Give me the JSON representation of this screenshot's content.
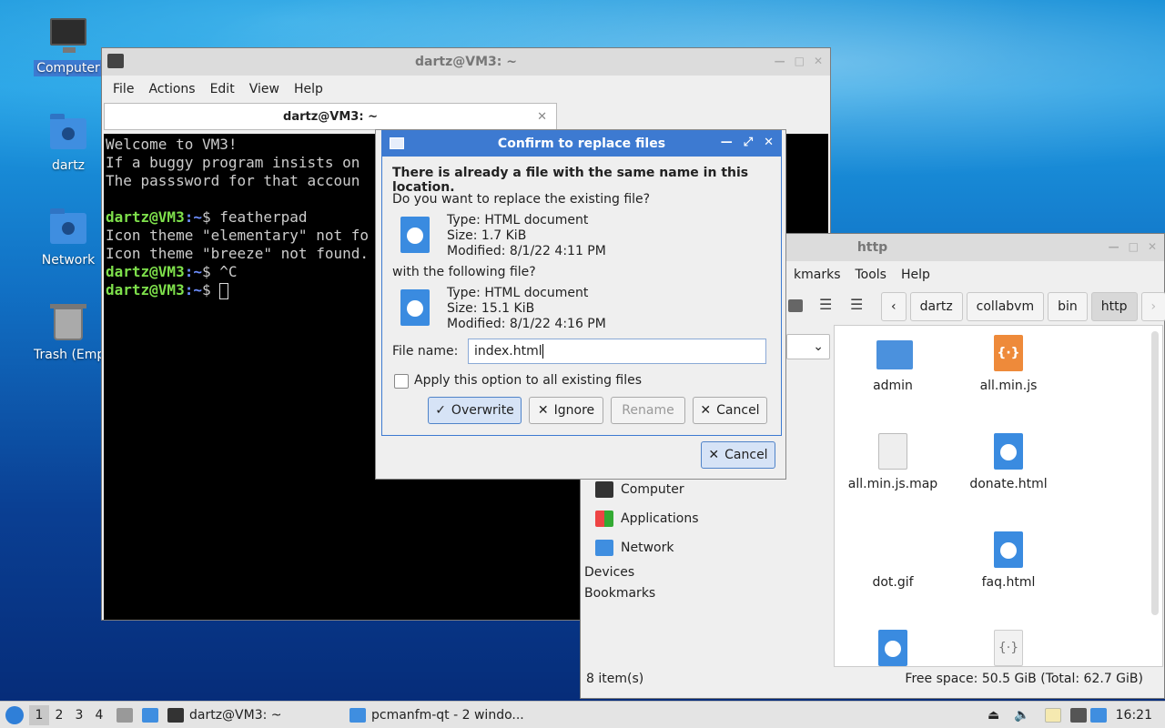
{
  "desktop": {
    "icons": [
      {
        "label": "Computer"
      },
      {
        "label": "dartz"
      },
      {
        "label": "Network"
      },
      {
        "label": "Trash (Empt"
      }
    ]
  },
  "terminal": {
    "title": "dartz@VM3: ~",
    "menu": [
      "File",
      "Actions",
      "Edit",
      "View",
      "Help"
    ],
    "tab_title": "dartz@VM3: ~",
    "lines": {
      "l1": "Welcome to VM3!",
      "l2": "If a buggy program insists on",
      "l3": "The passsword for that accoun",
      "l5_cmd": "featherpad",
      "l6": "Icon theme \"elementary\" not fo",
      "l7": "Icon theme \"breeze\" not found.",
      "l8_cmd": "^C"
    },
    "prompt_user": "dartz@VM3",
    "prompt_path": ":~",
    "prompt_sym": "$ "
  },
  "filemanager": {
    "title": "http",
    "menu": [
      "kmarks",
      "Tools",
      "Help"
    ],
    "breadcrumbs": [
      "dartz",
      "collabvm",
      "bin",
      "http"
    ],
    "side": {
      "computer": "Computer",
      "applications": "Applications",
      "network": "Network",
      "devices": "Devices",
      "bookmarks": "Bookmarks"
    },
    "files": [
      "admin",
      "all.min.js",
      "all.min.js.map",
      "donate.html",
      "dot.gif",
      "faq.html"
    ],
    "status_left": "8 item(s)",
    "status_right": "Free space: 50.5 GiB (Total: 62.7 GiB)"
  },
  "dialog": {
    "title": "Confirm to replace files",
    "headline": "There is already a file with the same name in this location.",
    "question": "Do you want to replace the existing file?",
    "existing": {
      "type": "Type: HTML document",
      "size": "Size: 1.7 KiB",
      "modified": "Modified: 8/1/22 4:11 PM"
    },
    "with_label": "with the following file?",
    "incoming": {
      "type": "Type: HTML document",
      "size": "Size: 15.1 KiB",
      "modified": "Modified: 8/1/22 4:16 PM"
    },
    "filename_label": "File name:",
    "filename_value": "index.html",
    "apply_all": "Apply this option to all existing files",
    "buttons": {
      "overwrite": "Overwrite",
      "ignore": "Ignore",
      "rename": "Rename",
      "cancel": "Cancel"
    },
    "outer_cancel": "Cancel"
  },
  "taskbar": {
    "workspaces": [
      "1",
      "2",
      "3",
      "4"
    ],
    "tasks": [
      "dartz@VM3: ~",
      "pcmanfm-qt - 2 windo..."
    ],
    "clock": "16:21"
  }
}
